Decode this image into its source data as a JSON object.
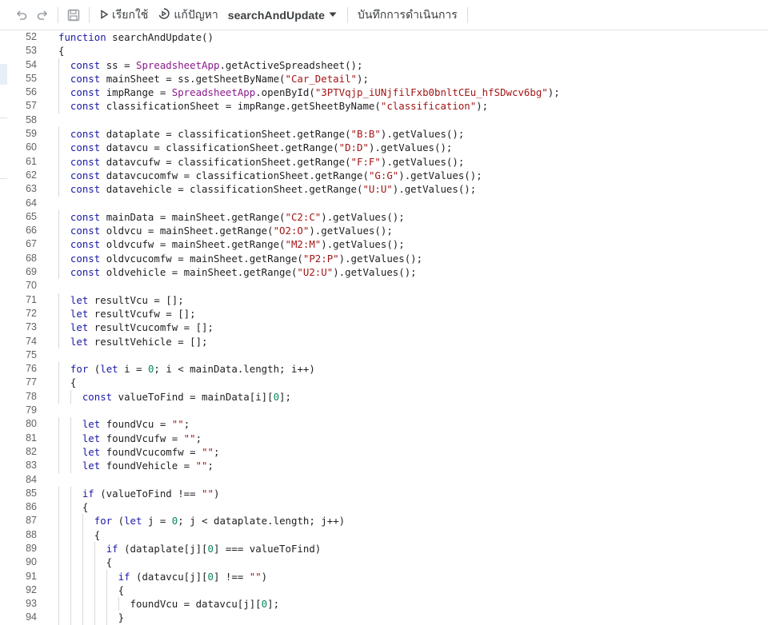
{
  "toolbar": {
    "undo_icon": "undo-icon",
    "redo_icon": "redo-icon",
    "save_icon": "save-icon",
    "run_label": "เรียกใช้",
    "debug_label": "แก้ปัญหา",
    "function_select": "searchAndUpdate",
    "execution_log_label": "บันทึกการดำเนินการ"
  },
  "code": {
    "lines": [
      {
        "n": "52",
        "text": "function searchAndUpdate()"
      },
      {
        "n": "53",
        "text": "{"
      },
      {
        "n": "54",
        "text": "  const ss = SpreadsheetApp.getActiveSpreadsheet();"
      },
      {
        "n": "55",
        "text": "  const mainSheet = ss.getSheetByName(\"Car_Detail\");"
      },
      {
        "n": "56",
        "text": "  const impRange = SpreadsheetApp.openById(\"3PTVqjp_iUNjfilFxb0bnltCEu_hfSDwcv6bg\");"
      },
      {
        "n": "57",
        "text": "  const classificationSheet = impRange.getSheetByName(\"classification\");"
      },
      {
        "n": "58",
        "text": ""
      },
      {
        "n": "59",
        "text": "  const dataplate = classificationSheet.getRange(\"B:B\").getValues();"
      },
      {
        "n": "60",
        "text": "  const datavcu = classificationSheet.getRange(\"D:D\").getValues();"
      },
      {
        "n": "61",
        "text": "  const datavcufw = classificationSheet.getRange(\"F:F\").getValues();"
      },
      {
        "n": "62",
        "text": "  const datavcucomfw = classificationSheet.getRange(\"G:G\").getValues();"
      },
      {
        "n": "63",
        "text": "  const datavehicle = classificationSheet.getRange(\"U:U\").getValues();"
      },
      {
        "n": "64",
        "text": ""
      },
      {
        "n": "65",
        "text": "  const mainData = mainSheet.getRange(\"C2:C\").getValues();"
      },
      {
        "n": "66",
        "text": "  const oldvcu = mainSheet.getRange(\"O2:O\").getValues();"
      },
      {
        "n": "67",
        "text": "  const oldvcufw = mainSheet.getRange(\"M2:M\").getValues();"
      },
      {
        "n": "68",
        "text": "  const oldvcucomfw = mainSheet.getRange(\"P2:P\").getValues();"
      },
      {
        "n": "69",
        "text": "  const oldvehicle = mainSheet.getRange(\"U2:U\").getValues();"
      },
      {
        "n": "70",
        "text": ""
      },
      {
        "n": "71",
        "text": "  let resultVcu = [];"
      },
      {
        "n": "72",
        "text": "  let resultVcufw = [];"
      },
      {
        "n": "73",
        "text": "  let resultVcucomfw = [];"
      },
      {
        "n": "74",
        "text": "  let resultVehicle = [];"
      },
      {
        "n": "75",
        "text": ""
      },
      {
        "n": "76",
        "text": "  for (let i = 0; i < mainData.length; i++)"
      },
      {
        "n": "77",
        "text": "  {"
      },
      {
        "n": "78",
        "text": "    const valueToFind = mainData[i][0];"
      },
      {
        "n": "79",
        "text": ""
      },
      {
        "n": "80",
        "text": "    let foundVcu = \"\";"
      },
      {
        "n": "81",
        "text": "    let foundVcufw = \"\";"
      },
      {
        "n": "82",
        "text": "    let foundVcucomfw = \"\";"
      },
      {
        "n": "83",
        "text": "    let foundVehicle = \"\";"
      },
      {
        "n": "84",
        "text": ""
      },
      {
        "n": "85",
        "text": "    if (valueToFind !== \"\")"
      },
      {
        "n": "86",
        "text": "    {"
      },
      {
        "n": "87",
        "text": "      for (let j = 0; j < dataplate.length; j++)"
      },
      {
        "n": "88",
        "text": "      {"
      },
      {
        "n": "89",
        "text": "        if (dataplate[j][0] === valueToFind)"
      },
      {
        "n": "90",
        "text": "        {"
      },
      {
        "n": "91",
        "text": "          if (datavcu[j][0] !== \"\")"
      },
      {
        "n": "92",
        "text": "          {"
      },
      {
        "n": "93",
        "text": "            foundVcu = datavcu[j][0];"
      },
      {
        "n": "94",
        "text": "          }"
      }
    ]
  }
}
